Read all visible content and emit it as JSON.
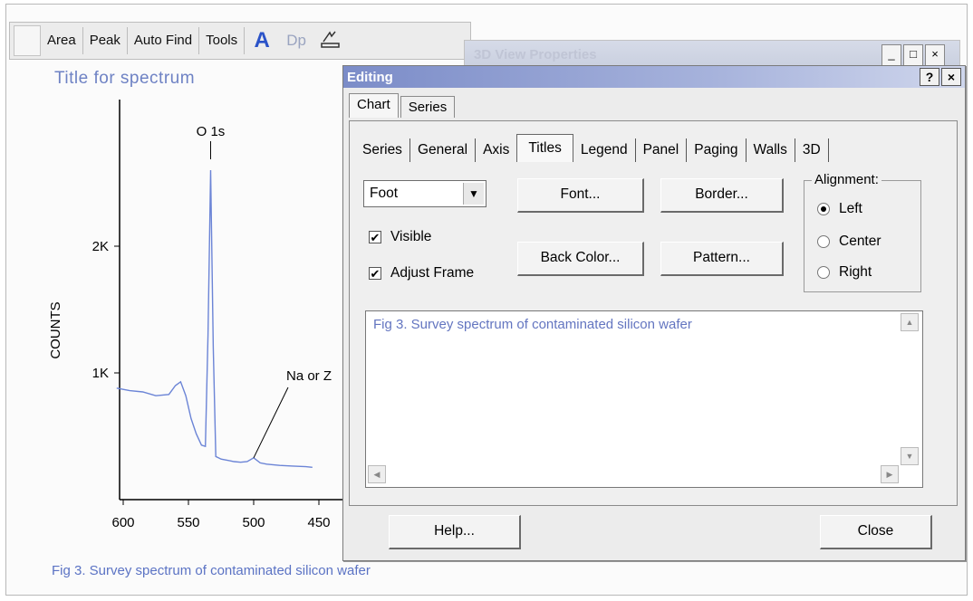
{
  "toolbar": {
    "area_label": "Area",
    "peak_label": "Peak",
    "autofind_label": "Auto Find",
    "tools_label": "Tools",
    "dp_label": "Dp",
    "icons": [
      "a-icon",
      "ruler-icon"
    ]
  },
  "spectrum": {
    "title": "Title for spectrum",
    "caption": "Fig 3. Survey spectrum of contaminated silicon wafer"
  },
  "behind_window": {
    "title": "3D View Properties",
    "controls": [
      "_",
      "□",
      "×"
    ]
  },
  "dialog": {
    "title": "Editing",
    "help_ctrl": "?",
    "close_ctrl": "×",
    "outer_tabs": [
      "Chart",
      "Series"
    ],
    "inner_tabs": [
      "Series",
      "General",
      "Axis",
      "Titles",
      "Legend",
      "Panel",
      "Paging",
      "Walls",
      "3D"
    ],
    "active_inner_tab": "Titles",
    "title_select_value": "Foot",
    "font_button": "Font...",
    "border_button": "Border...",
    "backcolor_button": "Back Color...",
    "pattern_button": "Pattern...",
    "visible_label": "Visible",
    "adjustframe_label": "Adjust Frame",
    "alignment_label": "Alignment:",
    "align_left": "Left",
    "align_center": "Center",
    "align_right": "Right",
    "memo_text": "Fig 3. Survey spectrum of contaminated silicon wafer",
    "help_button": "Help...",
    "close_button": "Close"
  },
  "chart_data": {
    "type": "line",
    "ylabel": "COUNTS",
    "yticks": [
      "1K",
      "2K"
    ],
    "xticks": [
      "600",
      "550",
      "500",
      "450"
    ],
    "annotations": [
      "O 1s",
      "Na or Z"
    ],
    "series": [
      {
        "x": [
          605,
          595,
          585,
          575,
          565,
          560,
          556,
          552,
          548,
          544,
          540,
          537,
          535,
          533,
          531,
          529,
          527,
          525,
          520,
          515,
          510,
          505,
          500,
          495,
          490,
          480,
          470,
          460,
          455
        ],
        "y": [
          880,
          860,
          850,
          820,
          830,
          900,
          930,
          820,
          640,
          520,
          430,
          420,
          1300,
          2600,
          1200,
          340,
          330,
          320,
          310,
          300,
          295,
          300,
          330,
          290,
          280,
          270,
          265,
          260,
          255
        ]
      }
    ]
  },
  "colors": {
    "spectrum_line": "#6b84d6",
    "caption_text": "#5b73c4",
    "title_bar_start": "#7b8cc8"
  }
}
